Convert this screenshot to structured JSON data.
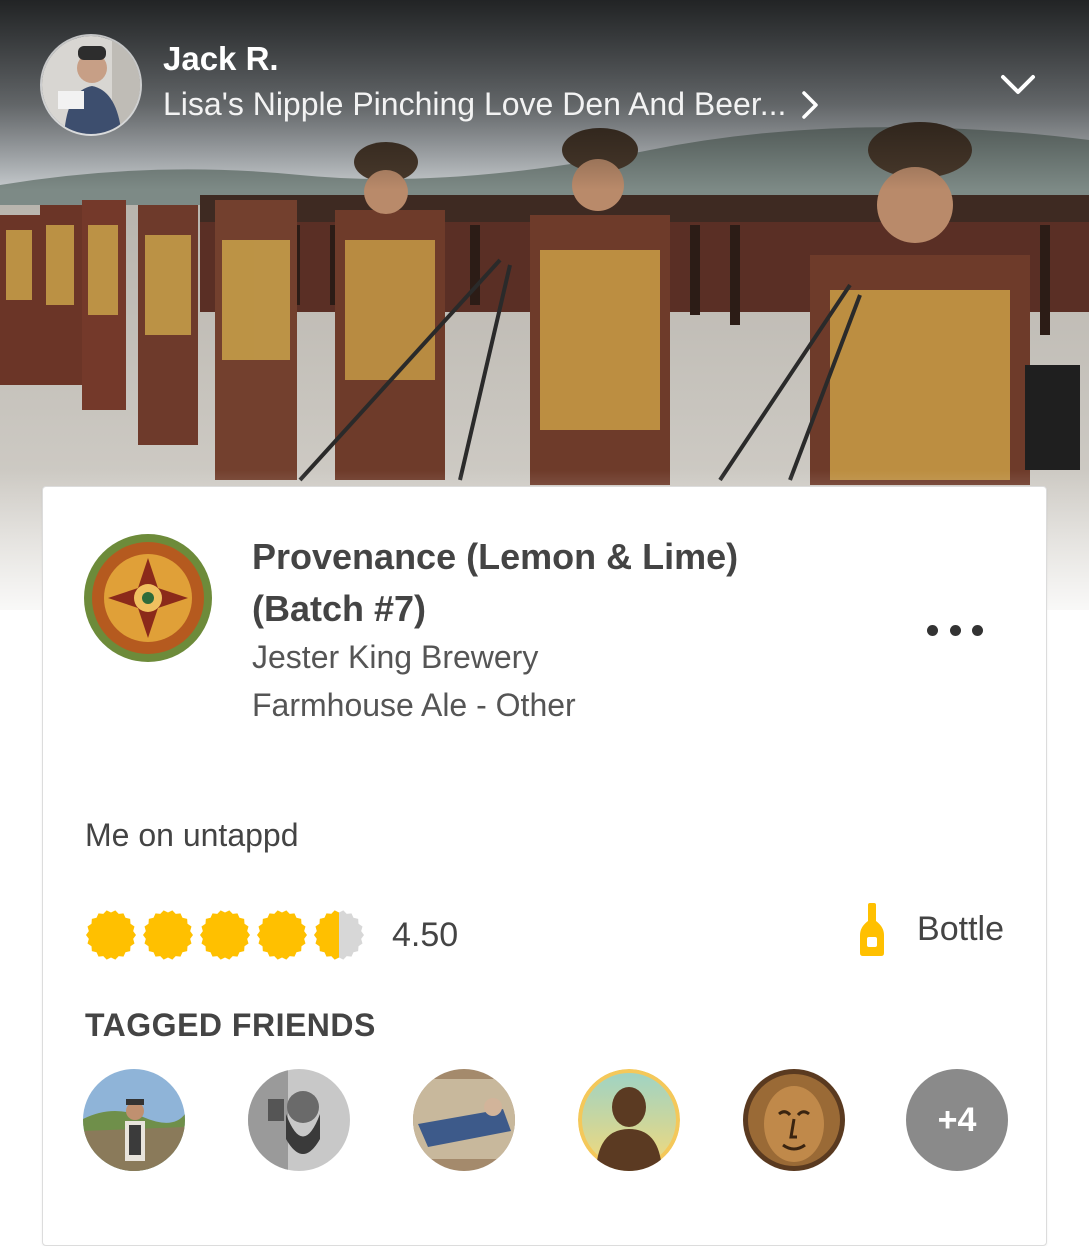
{
  "header": {
    "user_name": "Jack R.",
    "venue_name": "Lisa's Nipple Pinching Love Den And Beer...",
    "avatar_icon": "user-avatar-icon",
    "collapse_icon": "chevron-down-icon",
    "venue_icon": "chevron-right-icon"
  },
  "checkin": {
    "beer_name_line1": "Provenance (Lemon & Lime)",
    "beer_name_line2": "(Batch #7)",
    "brewery": "Jester King Brewery",
    "style": "Farmhouse Ale - Other",
    "comment": "Me on untappd",
    "rating": 4.5,
    "rating_text": "4.50",
    "serving": "Bottle",
    "serving_icon": "bottle-icon",
    "more_icon": "more-dots-icon"
  },
  "tagged": {
    "title": "TAGGED FRIENDS",
    "more_count": "+4"
  },
  "colors": {
    "accent_yellow": "#ffc000",
    "cap_empty": "#d7d7d7",
    "more_badge": "#8a8a8a"
  }
}
